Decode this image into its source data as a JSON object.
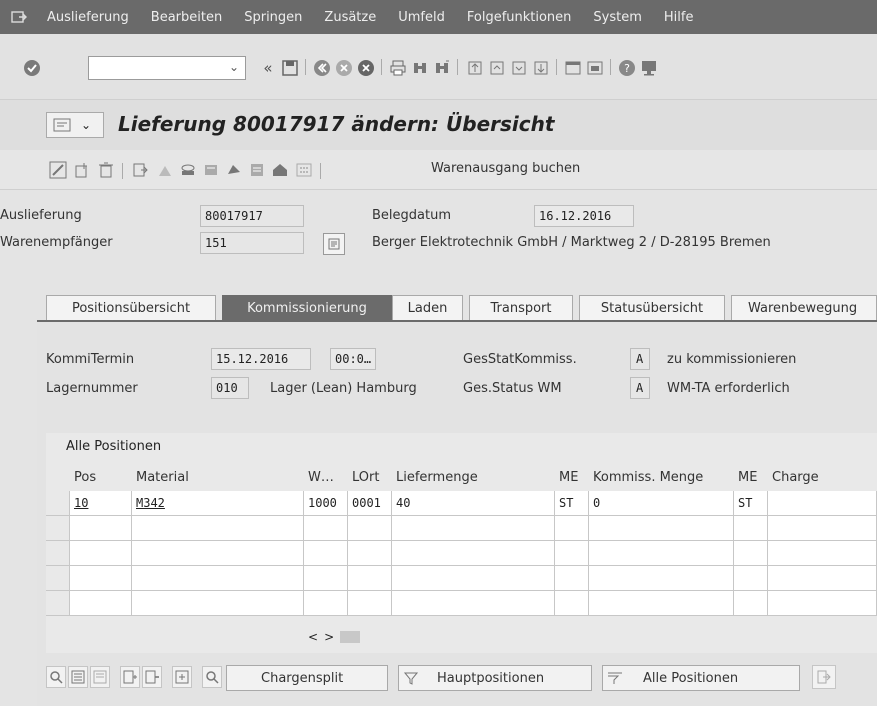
{
  "menu": {
    "items": [
      {
        "label": "Auslieferung"
      },
      {
        "label": "Bearbeiten"
      },
      {
        "label": "Springen"
      },
      {
        "label": "Zusätze"
      },
      {
        "label": "Umfeld"
      },
      {
        "label": "Folgefunktionen"
      },
      {
        "label": "System"
      },
      {
        "label": "Hilfe"
      }
    ]
  },
  "toolbar": {
    "command_value": "",
    "back_glyph": "«"
  },
  "title": {
    "text": "Lieferung 80017917 ändern: Übersicht"
  },
  "app_toolbar": {
    "post_goods_issue": "Warenausgang buchen"
  },
  "header": {
    "delivery_label": "Auslieferung",
    "delivery_value": "80017917",
    "doc_date_label": "Belegdatum",
    "doc_date_value": "16.12.2016",
    "ship_to_label": "Warenempfänger",
    "ship_to_value": "151",
    "ship_to_address": "Berger Elektrotechnik GmbH / Marktweg 2 / D-28195 Bremen"
  },
  "tabs": [
    {
      "label": "Positionsübersicht"
    },
    {
      "label": "Kommissionierung"
    },
    {
      "label": "Laden"
    },
    {
      "label": "Transport"
    },
    {
      "label": "Statusübersicht"
    },
    {
      "label": "Warenbewegung"
    }
  ],
  "picking": {
    "pick_date_label": "KommiTermin",
    "pick_date_value": "15.12.2016",
    "pick_time_value": "00:0…",
    "overall_pick_status_label": "GesStatKommiss.",
    "overall_pick_status_code": "A",
    "overall_pick_status_text": "zu kommissionieren",
    "warehouse_label": "Lagernummer",
    "warehouse_value": "010",
    "warehouse_text": "Lager (Lean) Hamburg",
    "wm_status_label": "Ges.Status WM",
    "wm_status_code": "A",
    "wm_status_text": "WM-TA erforderlich"
  },
  "table": {
    "title": "Alle Positionen",
    "columns": [
      "Pos",
      "Material",
      "W…",
      "LOrt",
      "Liefermenge",
      "ME",
      "Kommiss. Menge",
      "ME",
      "Charge"
    ],
    "rows": [
      [
        "10",
        "M342",
        "1000",
        "0001",
        "40",
        "ST",
        "0",
        "ST",
        ""
      ]
    ]
  },
  "buttons": {
    "batch_split": "Chargensplit",
    "main_items": "Hauptpositionen",
    "all_items": "Alle Positionen"
  }
}
